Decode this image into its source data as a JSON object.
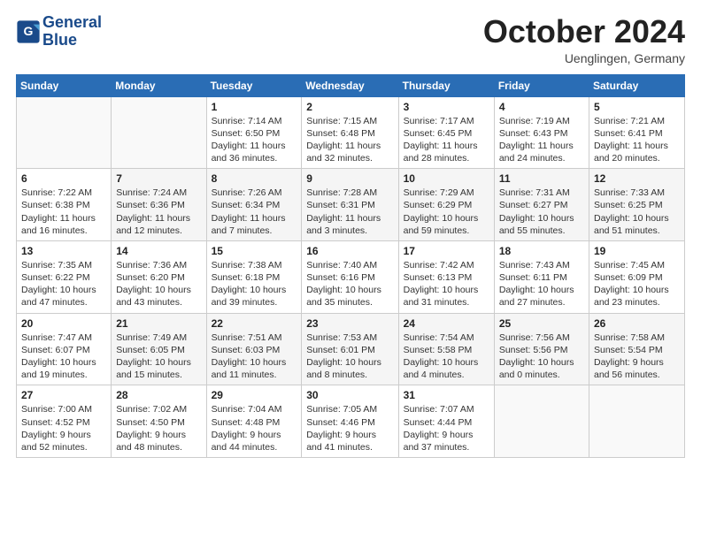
{
  "header": {
    "logo_line1": "General",
    "logo_line2": "Blue",
    "month_title": "October 2024",
    "location": "Uenglingen, Germany"
  },
  "days_of_week": [
    "Sunday",
    "Monday",
    "Tuesday",
    "Wednesday",
    "Thursday",
    "Friday",
    "Saturday"
  ],
  "weeks": [
    [
      {
        "day": "",
        "info": ""
      },
      {
        "day": "",
        "info": ""
      },
      {
        "day": "1",
        "info": "Sunrise: 7:14 AM\nSunset: 6:50 PM\nDaylight: 11 hours\nand 36 minutes."
      },
      {
        "day": "2",
        "info": "Sunrise: 7:15 AM\nSunset: 6:48 PM\nDaylight: 11 hours\nand 32 minutes."
      },
      {
        "day": "3",
        "info": "Sunrise: 7:17 AM\nSunset: 6:45 PM\nDaylight: 11 hours\nand 28 minutes."
      },
      {
        "day": "4",
        "info": "Sunrise: 7:19 AM\nSunset: 6:43 PM\nDaylight: 11 hours\nand 24 minutes."
      },
      {
        "day": "5",
        "info": "Sunrise: 7:21 AM\nSunset: 6:41 PM\nDaylight: 11 hours\nand 20 minutes."
      }
    ],
    [
      {
        "day": "6",
        "info": "Sunrise: 7:22 AM\nSunset: 6:38 PM\nDaylight: 11 hours\nand 16 minutes."
      },
      {
        "day": "7",
        "info": "Sunrise: 7:24 AM\nSunset: 6:36 PM\nDaylight: 11 hours\nand 12 minutes."
      },
      {
        "day": "8",
        "info": "Sunrise: 7:26 AM\nSunset: 6:34 PM\nDaylight: 11 hours\nand 7 minutes."
      },
      {
        "day": "9",
        "info": "Sunrise: 7:28 AM\nSunset: 6:31 PM\nDaylight: 11 hours\nand 3 minutes."
      },
      {
        "day": "10",
        "info": "Sunrise: 7:29 AM\nSunset: 6:29 PM\nDaylight: 10 hours\nand 59 minutes."
      },
      {
        "day": "11",
        "info": "Sunrise: 7:31 AM\nSunset: 6:27 PM\nDaylight: 10 hours\nand 55 minutes."
      },
      {
        "day": "12",
        "info": "Sunrise: 7:33 AM\nSunset: 6:25 PM\nDaylight: 10 hours\nand 51 minutes."
      }
    ],
    [
      {
        "day": "13",
        "info": "Sunrise: 7:35 AM\nSunset: 6:22 PM\nDaylight: 10 hours\nand 47 minutes."
      },
      {
        "day": "14",
        "info": "Sunrise: 7:36 AM\nSunset: 6:20 PM\nDaylight: 10 hours\nand 43 minutes."
      },
      {
        "day": "15",
        "info": "Sunrise: 7:38 AM\nSunset: 6:18 PM\nDaylight: 10 hours\nand 39 minutes."
      },
      {
        "day": "16",
        "info": "Sunrise: 7:40 AM\nSunset: 6:16 PM\nDaylight: 10 hours\nand 35 minutes."
      },
      {
        "day": "17",
        "info": "Sunrise: 7:42 AM\nSunset: 6:13 PM\nDaylight: 10 hours\nand 31 minutes."
      },
      {
        "day": "18",
        "info": "Sunrise: 7:43 AM\nSunset: 6:11 PM\nDaylight: 10 hours\nand 27 minutes."
      },
      {
        "day": "19",
        "info": "Sunrise: 7:45 AM\nSunset: 6:09 PM\nDaylight: 10 hours\nand 23 minutes."
      }
    ],
    [
      {
        "day": "20",
        "info": "Sunrise: 7:47 AM\nSunset: 6:07 PM\nDaylight: 10 hours\nand 19 minutes."
      },
      {
        "day": "21",
        "info": "Sunrise: 7:49 AM\nSunset: 6:05 PM\nDaylight: 10 hours\nand 15 minutes."
      },
      {
        "day": "22",
        "info": "Sunrise: 7:51 AM\nSunset: 6:03 PM\nDaylight: 10 hours\nand 11 minutes."
      },
      {
        "day": "23",
        "info": "Sunrise: 7:53 AM\nSunset: 6:01 PM\nDaylight: 10 hours\nand 8 minutes."
      },
      {
        "day": "24",
        "info": "Sunrise: 7:54 AM\nSunset: 5:58 PM\nDaylight: 10 hours\nand 4 minutes."
      },
      {
        "day": "25",
        "info": "Sunrise: 7:56 AM\nSunset: 5:56 PM\nDaylight: 10 hours\nand 0 minutes."
      },
      {
        "day": "26",
        "info": "Sunrise: 7:58 AM\nSunset: 5:54 PM\nDaylight: 9 hours\nand 56 minutes."
      }
    ],
    [
      {
        "day": "27",
        "info": "Sunrise: 7:00 AM\nSunset: 4:52 PM\nDaylight: 9 hours\nand 52 minutes."
      },
      {
        "day": "28",
        "info": "Sunrise: 7:02 AM\nSunset: 4:50 PM\nDaylight: 9 hours\nand 48 minutes."
      },
      {
        "day": "29",
        "info": "Sunrise: 7:04 AM\nSunset: 4:48 PM\nDaylight: 9 hours\nand 44 minutes."
      },
      {
        "day": "30",
        "info": "Sunrise: 7:05 AM\nSunset: 4:46 PM\nDaylight: 9 hours\nand 41 minutes."
      },
      {
        "day": "31",
        "info": "Sunrise: 7:07 AM\nSunset: 4:44 PM\nDaylight: 9 hours\nand 37 minutes."
      },
      {
        "day": "",
        "info": ""
      },
      {
        "day": "",
        "info": ""
      }
    ]
  ]
}
